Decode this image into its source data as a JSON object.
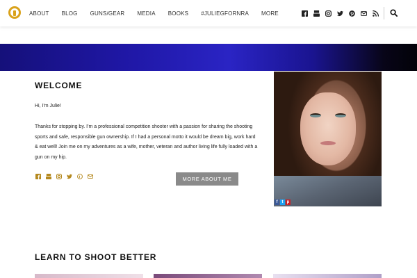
{
  "nav": {
    "items": [
      "ABOUT",
      "BLOG",
      "GUNS/GEAR",
      "MEDIA",
      "BOOKS",
      "#JULIEGFORNRA",
      "MORE"
    ]
  },
  "social_icons": [
    "facebook-icon",
    "youtube-icon",
    "instagram-icon",
    "twitter-icon",
    "pinterest-icon",
    "email-icon",
    "rss-icon"
  ],
  "welcome": {
    "title": "WELCOME",
    "greeting": "Hi, I'm Julie!",
    "body": "Thanks for stopping by. I'm a professional competition shooter with a passion for sharing the shooting sports and safe, responsible gun ownership.  If I had a personal motto it would be dream big, work hard & eat well! Join me on my adventures as a wife, mother, veteran and author living life fully loaded with a gun on my hip.",
    "button_label": "MORE ABOUT ME"
  },
  "share": {
    "facebook": "f",
    "twitter": "t",
    "pinterest": "p"
  },
  "learn": {
    "title": "LEARN TO SHOOT BETTER"
  },
  "colors": {
    "accent": "#d9a21b",
    "button": "#8a8a8a",
    "banner": "#1f17a5"
  }
}
